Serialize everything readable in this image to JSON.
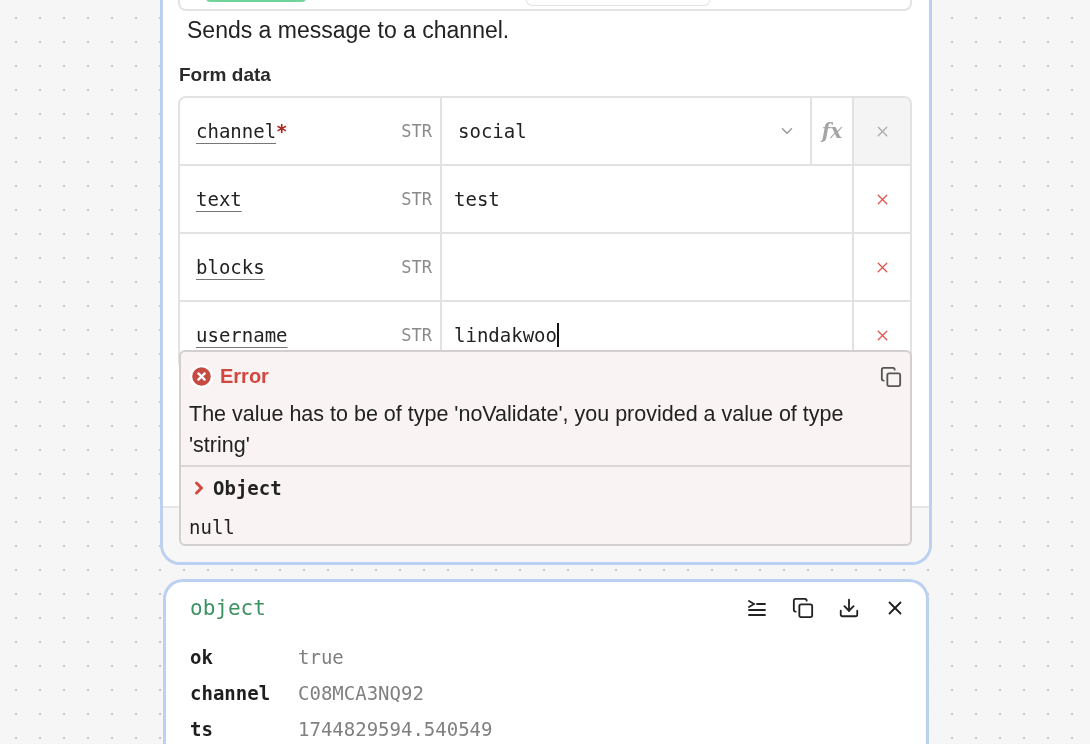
{
  "description": "Sends a message to a channel.",
  "form": {
    "title": "Form data",
    "fields": [
      {
        "name": "channel",
        "required_mark": "*",
        "type": "STR",
        "kind": "select",
        "value": "social",
        "formula_label": "fx",
        "remove_disabled": true
      },
      {
        "name": "text",
        "type": "STR",
        "kind": "text",
        "value": "test",
        "remove_disabled": false
      },
      {
        "name": "blocks",
        "type": "STR",
        "kind": "text",
        "remove_disabled": false
      },
      {
        "name": "username",
        "type": "STR",
        "kind": "text",
        "value": "lindakwoo",
        "remove_disabled": false,
        "focused": true
      }
    ]
  },
  "error": {
    "title": "Error",
    "message": "The value has to be of type 'noValidate', you provided a value of type 'string'",
    "details": {
      "label": "Object",
      "value": "null",
      "expanded": false
    }
  },
  "result": {
    "type_label": "object",
    "entries": [
      {
        "key": "ok",
        "value": "true"
      },
      {
        "key": "channel",
        "value": "C08MCA3NQ92"
      },
      {
        "key": "ts",
        "value": "1744829594.540549"
      }
    ]
  }
}
